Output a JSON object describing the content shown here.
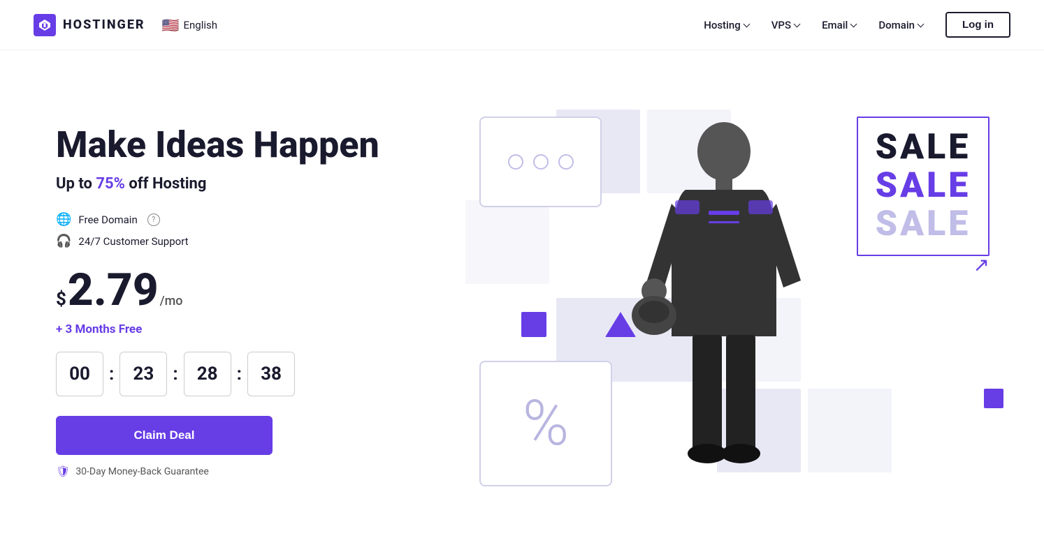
{
  "navbar": {
    "logo_text": "HOSTINGER",
    "lang": {
      "flag": "🇺🇸",
      "label": "English"
    },
    "nav_items": [
      {
        "id": "hosting",
        "label": "Hosting",
        "has_dropdown": true
      },
      {
        "id": "vps",
        "label": "VPS",
        "has_dropdown": true
      },
      {
        "id": "email",
        "label": "Email",
        "has_dropdown": true
      },
      {
        "id": "domain",
        "label": "Domain",
        "has_dropdown": true
      }
    ],
    "login_label": "Log in"
  },
  "hero": {
    "title": "Make Ideas Happen",
    "subtitle_prefix": "Up to ",
    "subtitle_highlight": "75%",
    "subtitle_suffix": " off Hosting",
    "features": [
      {
        "id": "domain",
        "text": "Free Domain",
        "has_info": true
      },
      {
        "id": "support",
        "text": "24/7 Customer Support",
        "has_info": false
      }
    ],
    "price": {
      "currency": "$",
      "amount": "2.79",
      "per": "/mo"
    },
    "months_free": "+ 3 Months Free",
    "countdown": {
      "hours": "00",
      "minutes": "23",
      "seconds": "28",
      "frames": "38"
    },
    "cta_label": "Claim Deal",
    "guarantee": "30-Day Money-Back Guarantee"
  },
  "sale_graphic": {
    "line1": "SALE",
    "line2": "SALE",
    "line3": "SALE"
  }
}
